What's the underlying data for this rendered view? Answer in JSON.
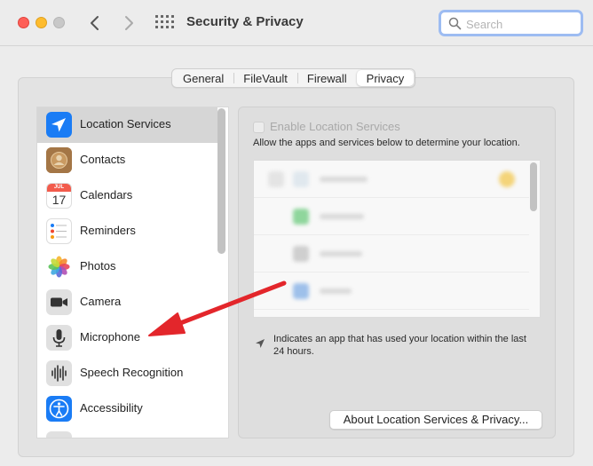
{
  "window": {
    "title": "Security & Privacy"
  },
  "search": {
    "placeholder": "Search",
    "value": ""
  },
  "tabs": [
    {
      "label": "General",
      "active": false
    },
    {
      "label": "FileVault",
      "active": false
    },
    {
      "label": "Firewall",
      "active": false
    },
    {
      "label": "Privacy",
      "active": true
    }
  ],
  "sidebar": {
    "items": [
      {
        "label": "Location Services",
        "icon": "location-arrow-icon",
        "selected": true
      },
      {
        "label": "Contacts",
        "icon": "contacts-icon",
        "selected": false
      },
      {
        "label": "Calendars",
        "icon": "calendar-icon",
        "selected": false,
        "calendar_month": "JUL",
        "calendar_day": "17"
      },
      {
        "label": "Reminders",
        "icon": "reminders-icon",
        "selected": false
      },
      {
        "label": "Photos",
        "icon": "photos-icon",
        "selected": false
      },
      {
        "label": "Camera",
        "icon": "camera-icon",
        "selected": false
      },
      {
        "label": "Microphone",
        "icon": "microphone-icon",
        "selected": false
      },
      {
        "label": "Speech Recognition",
        "icon": "speech-waveform-icon",
        "selected": false
      },
      {
        "label": "Accessibility",
        "icon": "accessibility-icon",
        "selected": false
      }
    ]
  },
  "location": {
    "enable_label": "Enable Location Services",
    "enabled": false,
    "description": "Allow the apps and services below to determine your location.",
    "note": "Indicates an app that has used your location within the last 24 hours.",
    "about_button": "About Location Services & Privacy..."
  },
  "colors": {
    "accent": "#1a7cf5",
    "annotation_arrow": "#e3262b",
    "search_focus": "#9dbcf2"
  }
}
